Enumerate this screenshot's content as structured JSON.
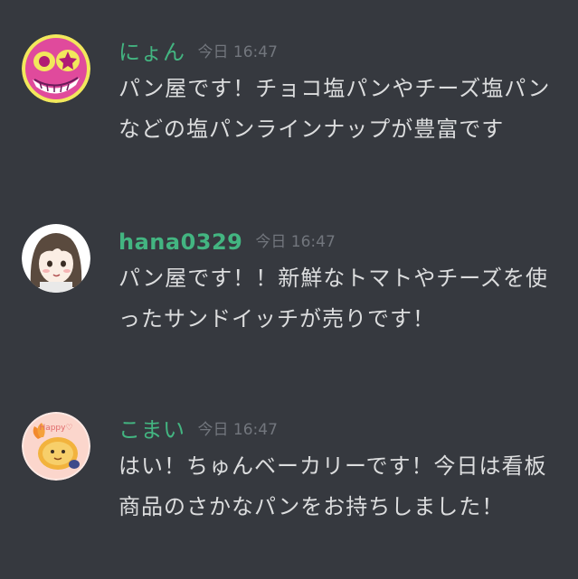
{
  "messages": [
    {
      "username": "にょん",
      "username_color": "#43b581",
      "timestamp": "今日 16:47",
      "avatar_icon": "pink-star-eyes-creature-avatar",
      "content": "パン屋です！チョコ塩パンやチーズ塩パンなどの塩パンラインナップが豊富です"
    },
    {
      "username": "hana0329",
      "username_color": "#43b581",
      "timestamp": "今日 16:47",
      "avatar_icon": "anime-girl-drawing-avatar",
      "content": "パン屋です！！新鮮なトマトやチーズを使ったサンドイッチが売りです！"
    },
    {
      "username": "こまい",
      "username_color": "#43b581",
      "timestamp": "今日 16:47",
      "avatar_icon": "fried-shrimp-character-avatar",
      "avatar_text": "Happy♡",
      "content": "はい！ちゅんベーカリーです！今日は看板商品のさかなパンをお持ちしました！"
    }
  ]
}
